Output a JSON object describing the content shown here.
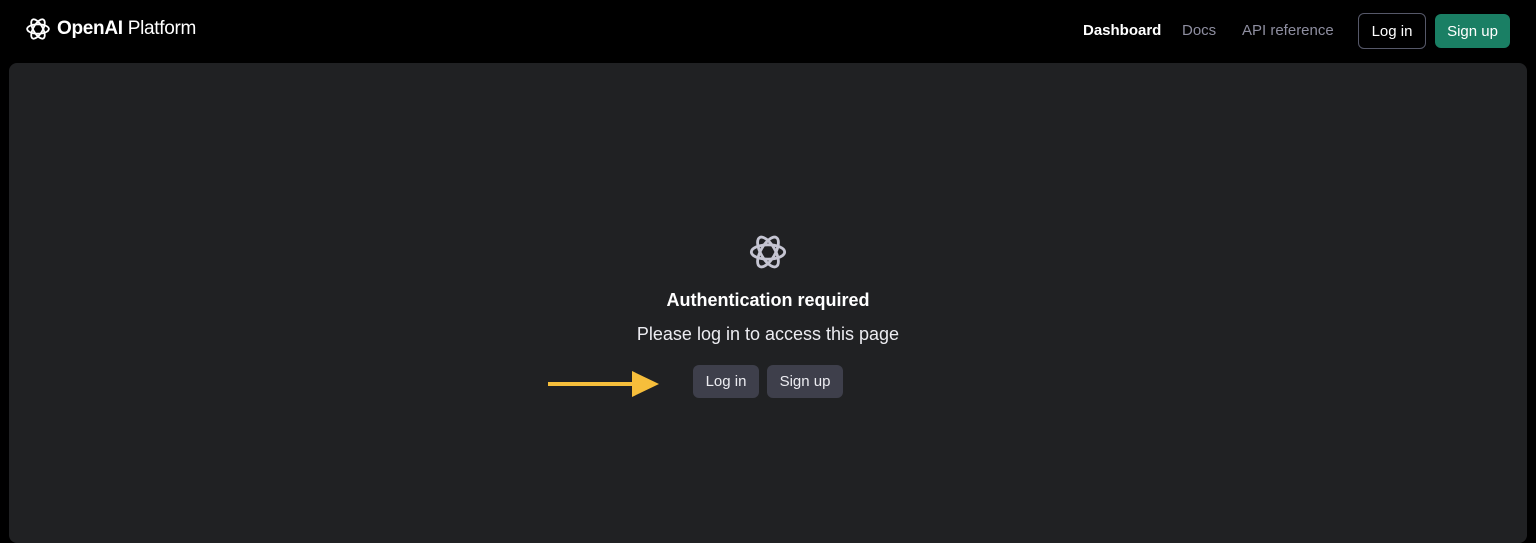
{
  "header": {
    "brand_strong": "OpenAI",
    "brand_light": " Platform",
    "nav": {
      "dashboard": "Dashboard",
      "docs": "Docs",
      "api_reference": "API reference"
    },
    "login_label": "Log in",
    "signup_label": "Sign up"
  },
  "main": {
    "title": "Authentication required",
    "subtitle": "Please log in to access this page",
    "login_label": "Log in",
    "signup_label": "Sign up"
  },
  "icons": {
    "brand": "openai-logo-icon",
    "center": "openai-logo-icon",
    "annotation": "arrow-right-icon"
  },
  "colors": {
    "background": "#000000",
    "panel": "#202123",
    "accent_green": "#1a7f64",
    "annotation_arrow": "#f6be3b",
    "muted_text": "#8e8ea0",
    "button_dark": "#3e3f4b"
  }
}
